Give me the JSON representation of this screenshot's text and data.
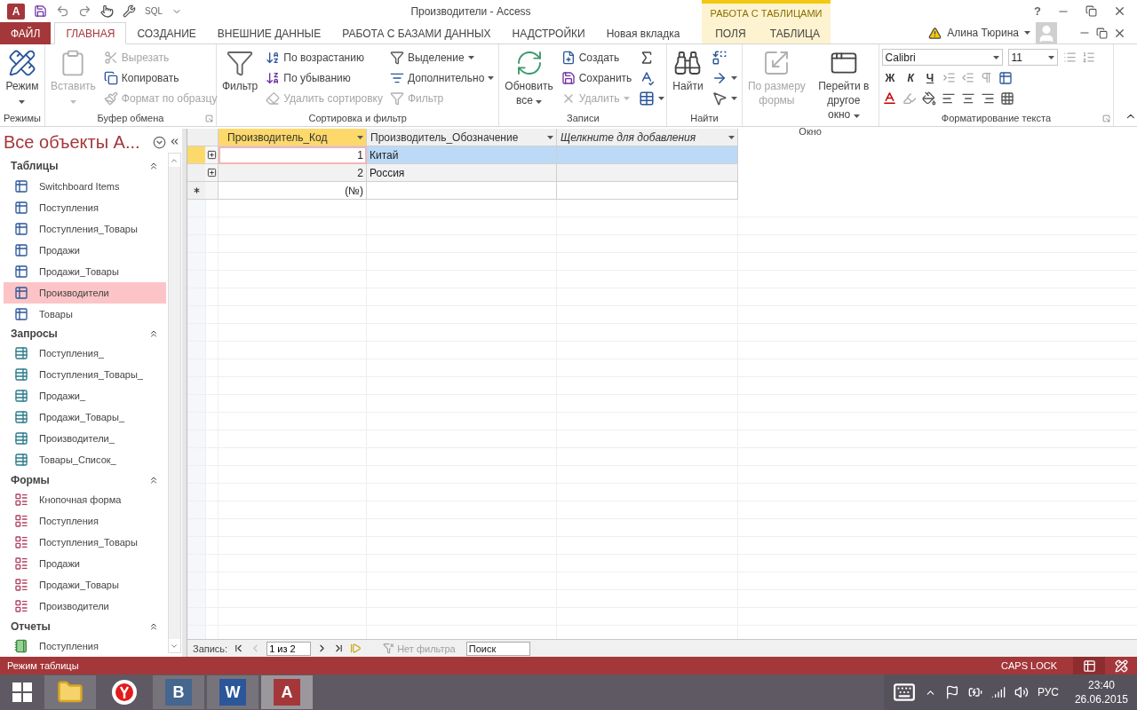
{
  "title_bar": {
    "app_letter": "A",
    "quick_access_label": "SQL",
    "title": "Производители - Access",
    "context_group": "РАБОТА С ТАБЛИЦАМИ",
    "help": "?"
  },
  "tabs": [
    {
      "label": "ФАЙЛ",
      "kind": "file",
      "selected": false
    },
    {
      "label": "ГЛАВНАЯ",
      "kind": "normal",
      "selected": true
    },
    {
      "label": "СОЗДАНИЕ",
      "kind": "normal",
      "selected": false
    },
    {
      "label": "ВНЕШНИЕ ДАННЫЕ",
      "kind": "normal",
      "selected": false
    },
    {
      "label": "РАБОТА С БАЗАМИ ДАННЫХ",
      "kind": "normal",
      "selected": false
    },
    {
      "label": "НАДСТРОЙКИ",
      "kind": "normal",
      "selected": false
    },
    {
      "label": "Новая вкладка",
      "kind": "normal",
      "selected": false
    },
    {
      "label": "ПОЛЯ",
      "kind": "context",
      "selected": false
    },
    {
      "label": "ТАБЛИЦА",
      "kind": "context",
      "selected": false
    }
  ],
  "user": {
    "name": "Алина Тюрина"
  },
  "ribbon": {
    "groups": [
      {
        "label": "Режимы",
        "kind": "buttons",
        "launcher": false,
        "columns": [
          [
            {
              "label": "Режим",
              "kind": "large",
              "disabled": false,
              "dropdown": true
            }
          ]
        ]
      },
      {
        "label": "Буфер обмена",
        "kind": "buttons",
        "launcher": true,
        "columns": [
          [
            {
              "label": "Вставить",
              "kind": "large",
              "disabled": true,
              "dropdown": true
            }
          ],
          [
            {
              "label": "Вырезать",
              "kind": "small",
              "disabled": true,
              "dropdown": false
            },
            {
              "label": "Копировать",
              "kind": "small",
              "disabled": false,
              "dropdown": false
            },
            {
              "label": "Формат по образцу",
              "kind": "small",
              "disabled": true,
              "dropdown": false
            }
          ]
        ]
      },
      {
        "label": "Сортировка и фильтр",
        "kind": "buttons",
        "launcher": false,
        "columns": [
          [
            {
              "label": "Фильтр",
              "kind": "large",
              "disabled": false,
              "dropdown": false
            }
          ],
          [
            {
              "label": "По возрастанию",
              "kind": "small",
              "disabled": false,
              "dropdown": false
            },
            {
              "label": "По убыванию",
              "kind": "small",
              "disabled": false,
              "dropdown": false
            },
            {
              "label": "Удалить сортировку",
              "kind": "small",
              "disabled": true,
              "dropdown": false
            }
          ],
          [
            {
              "label": "Выделение",
              "kind": "small",
              "disabled": false,
              "dropdown": true
            },
            {
              "label": "Дополнительно",
              "kind": "small",
              "disabled": false,
              "dropdown": true
            },
            {
              "label": "Фильтр",
              "kind": "small",
              "disabled": true,
              "dropdown": false
            }
          ]
        ]
      },
      {
        "label": "Записи",
        "kind": "buttons",
        "launcher": false,
        "columns": [
          [
            {
              "label": "Обновить все",
              "kind": "large",
              "disabled": false,
              "dropdown": true
            }
          ],
          [
            {
              "label": "Создать",
              "kind": "small",
              "disabled": false,
              "dropdown": false
            },
            {
              "label": "Сохранить",
              "kind": "small",
              "disabled": false,
              "dropdown": false
            },
            {
              "label": "Удалить",
              "kind": "small",
              "disabled": true,
              "dropdown": true
            }
          ],
          [
            {
              "kind": "icon",
              "disabled": false,
              "dropdown": false
            },
            {
              "kind": "icon",
              "disabled": false,
              "dropdown": false
            },
            {
              "kind": "icon",
              "disabled": false,
              "dropdown": true
            }
          ]
        ]
      },
      {
        "label": "Найти",
        "kind": "buttons",
        "launcher": false,
        "columns": [
          [
            {
              "label": "Найти",
              "kind": "large",
              "disabled": false,
              "dropdown": false
            }
          ],
          [
            {
              "kind": "icon",
              "disabled": false,
              "dropdown": false
            },
            {
              "kind": "icon",
              "disabled": false,
              "dropdown": true
            },
            {
              "kind": "icon",
              "disabled": false,
              "dropdown": true
            }
          ]
        ]
      },
      {
        "label": "Окно",
        "kind": "buttons",
        "launcher": false,
        "columns": [
          [
            {
              "label": "По размеру формы",
              "kind": "large",
              "disabled": true,
              "dropdown": false
            }
          ],
          [
            {
              "label": "Перейти в другое окно",
              "kind": "large",
              "disabled": false,
              "dropdown": true
            }
          ]
        ]
      },
      {
        "label": "Форматирование текста",
        "kind": "font",
        "launcher": true,
        "font": "Calibri",
        "size": "11",
        "styles": [
          "Ж",
          "К",
          "Ч"
        ]
      }
    ]
  },
  "navigation": {
    "title": "Все объекты А...",
    "sections": [
      {
        "label": "Таблицы",
        "expanded": true,
        "items": [
          {
            "label": "Switchboard Items",
            "kind": "table",
            "selected": false
          },
          {
            "label": "Поступления",
            "kind": "table",
            "selected": false
          },
          {
            "label": "Поступления_Товары",
            "kind": "table",
            "selected": false
          },
          {
            "label": "Продажи",
            "kind": "table",
            "selected": false
          },
          {
            "label": "Продажи_Товары",
            "kind": "table",
            "selected": false
          },
          {
            "label": "Производители",
            "kind": "table",
            "selected": true
          },
          {
            "label": "Товары",
            "kind": "table",
            "selected": false
          }
        ]
      },
      {
        "label": "Запросы",
        "expanded": true,
        "items": [
          {
            "label": "Поступления_",
            "kind": "query",
            "selected": false
          },
          {
            "label": "Поступления_Товары_",
            "kind": "query",
            "selected": false
          },
          {
            "label": "Продажи_",
            "kind": "query",
            "selected": false
          },
          {
            "label": "Продажи_Товары_",
            "kind": "query",
            "selected": false
          },
          {
            "label": "Производители_",
            "kind": "query",
            "selected": false
          },
          {
            "label": "Товары_Список_",
            "kind": "query",
            "selected": false
          }
        ]
      },
      {
        "label": "Формы",
        "expanded": true,
        "items": [
          {
            "label": "Кнопочная форма",
            "kind": "form",
            "selected": false
          },
          {
            "label": "Поступления",
            "kind": "form",
            "selected": false
          },
          {
            "label": "Поступления_Товары",
            "kind": "form",
            "selected": false
          },
          {
            "label": "Продажи",
            "kind": "form",
            "selected": false
          },
          {
            "label": "Продажи_Товары",
            "kind": "form",
            "selected": false
          },
          {
            "label": "Производители",
            "kind": "form",
            "selected": false
          }
        ]
      },
      {
        "label": "Отчеты",
        "expanded": true,
        "items": [
          {
            "label": "Поступления",
            "kind": "report",
            "selected": false
          }
        ]
      }
    ]
  },
  "datasheet": {
    "columns": [
      {
        "label": "Производитель_Код",
        "kind": "field",
        "selected": true
      },
      {
        "label": "Производитель_Обозначение",
        "kind": "field",
        "selected": false
      },
      {
        "label": "Щелкните для добавления",
        "kind": "add",
        "selected": false
      }
    ],
    "rows": [
      {
        "kind": "record",
        "selected": true,
        "cells": [
          "1",
          "Китай"
        ]
      },
      {
        "kind": "record",
        "selected": false,
        "cells": [
          "2",
          "Россия"
        ]
      },
      {
        "kind": "new",
        "selected": false,
        "cells": [
          "(№)"
        ]
      }
    ]
  },
  "record_navigator": {
    "label": "Запись:",
    "position": "1 из 2",
    "filter": "Нет фильтра",
    "search_placeholder": "Поиск"
  },
  "status_bar": {
    "mode": "Режим таблицы",
    "indicator": "CAPS LOCK",
    "views": [
      {
        "kind": "datasheet",
        "selected": true
      },
      {
        "kind": "design",
        "selected": false
      }
    ]
  },
  "taskbar": {
    "apps": [
      {
        "kind": "explorer",
        "running": true,
        "selected": false
      },
      {
        "kind": "yandex",
        "running": false,
        "selected": false
      },
      {
        "kind": "vk",
        "letter": "B",
        "running": true,
        "selected": false
      },
      {
        "kind": "word",
        "letter": "W",
        "running": true,
        "selected": false
      },
      {
        "kind": "access",
        "letter": "A",
        "running": true,
        "selected": true
      }
    ],
    "language": "РУС",
    "time": "23:40",
    "date": "26.06.2015"
  }
}
